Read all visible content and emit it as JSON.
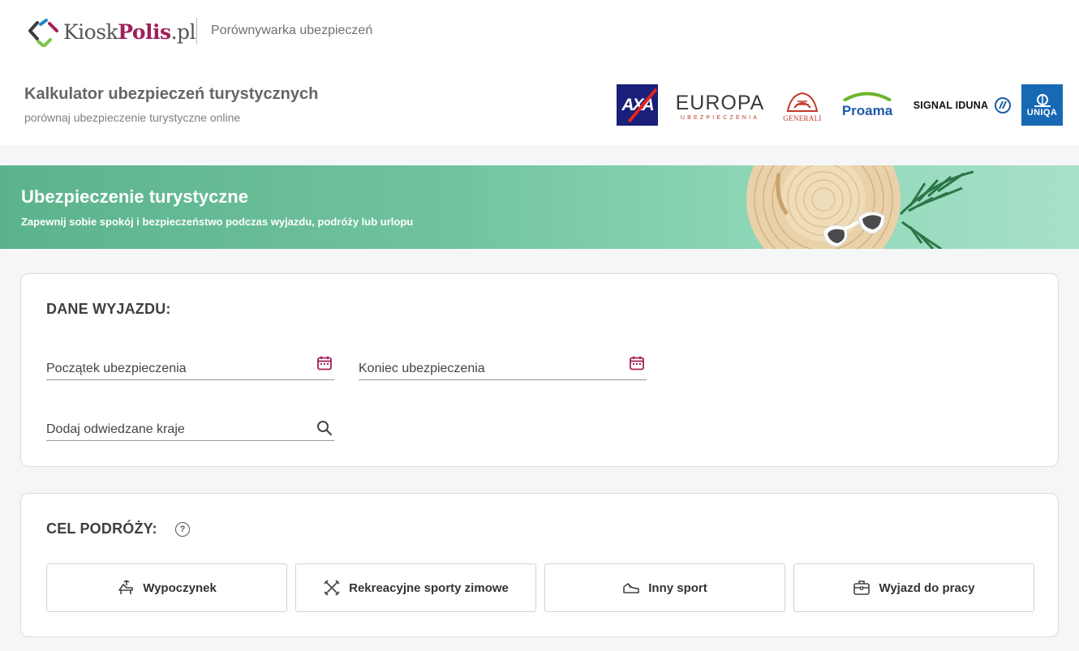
{
  "brand": {
    "logo_prefix": "Kiosk",
    "logo_bold": "Polis",
    "logo_suffix": ".pl",
    "tagline": "Porównywarka ubezpieczeń"
  },
  "subheader": {
    "title": "Kalkulator ubezpieczeń turystycznych",
    "subtitle": "porównaj ubezpieczenie turystyczne online"
  },
  "insurers": {
    "axa": "AXA",
    "europa": "EUROPA",
    "europa_sub": "UBEZPIECZENIA",
    "generali": "GENERALI",
    "proama": "Proama",
    "signal_iduna": "SIGNAL IDUNA",
    "uniqa": "UNIQA"
  },
  "banner": {
    "title": "Ubezpieczenie turystyczne",
    "subtitle": "Zapewnij sobie spokój i bezpieczeństwo podczas wyjazdu, podróży lub urlopu"
  },
  "trip_details": {
    "title": "DANE WYJAZDU:",
    "start_placeholder": "Początek ubezpieczenia",
    "end_placeholder": "Koniec ubezpieczenia",
    "countries_placeholder": "Dodaj odwiedzane kraje"
  },
  "trip_purpose": {
    "title": "CEL PODRÓŻY:",
    "help_glyph": "?",
    "options": [
      "Wypoczynek",
      "Rekreacyjne sporty zimowe",
      "Inny sport",
      "Wyjazd do pracy"
    ]
  },
  "colors": {
    "brand_primary": "#a0205a",
    "banner_start": "#5bb38c",
    "banner_end": "#a7e1c8",
    "calendar_icon": "#a0205a"
  },
  "icons": {
    "start_date": "calendar-icon",
    "end_date": "calendar-icon",
    "countries": "search-icon",
    "help": "question-circle-icon",
    "purpose_0": "sun-lounger-icon",
    "purpose_1": "skis-icon",
    "purpose_2": "sneaker-icon",
    "purpose_3": "briefcase-icon"
  }
}
